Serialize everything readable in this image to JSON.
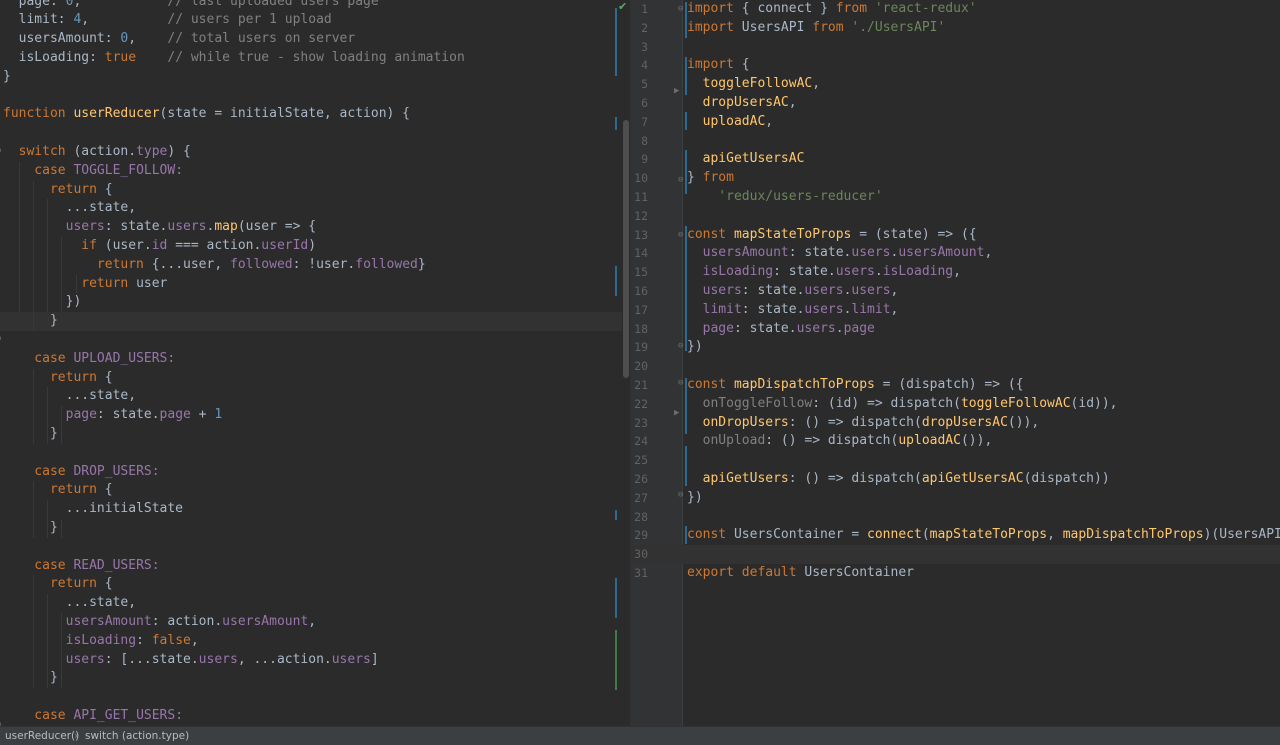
{
  "left_editor": {
    "lines": [
      {
        "segments": [
          {
            "t": "  page: ",
            "c": ""
          },
          {
            "t": "0",
            "c": "n"
          },
          {
            "t": ",           ",
            "c": ""
          },
          {
            "t": "// last uploaded users page",
            "c": "c"
          }
        ]
      },
      {
        "segments": [
          {
            "t": "  limit: ",
            "c": ""
          },
          {
            "t": "4",
            "c": "n"
          },
          {
            "t": ",          ",
            "c": ""
          },
          {
            "t": "// users per 1 upload",
            "c": "c"
          }
        ]
      },
      {
        "segments": [
          {
            "t": "  usersAmount: ",
            "c": ""
          },
          {
            "t": "0",
            "c": "n"
          },
          {
            "t": ",    ",
            "c": ""
          },
          {
            "t": "// total users on server",
            "c": "c"
          }
        ]
      },
      {
        "segments": [
          {
            "t": "  isLoading: ",
            "c": ""
          },
          {
            "t": "true",
            "c": "k"
          },
          {
            "t": "    ",
            "c": ""
          },
          {
            "t": "// while true - show loading animation",
            "c": "c"
          }
        ]
      },
      {
        "segments": [
          {
            "t": "}",
            "c": ""
          }
        ]
      },
      {
        "segments": [
          {
            "t": "",
            "c": ""
          }
        ]
      },
      {
        "segments": [
          {
            "t": "function ",
            "c": "k"
          },
          {
            "t": "userReducer",
            "c": "f"
          },
          {
            "t": "(state = initialState, action) {",
            "c": ""
          }
        ]
      },
      {
        "segments": [
          {
            "t": "",
            "c": ""
          }
        ]
      },
      {
        "segments": [
          {
            "t": "  switch ",
            "c": "k"
          },
          {
            "t": "(action.",
            "c": ""
          },
          {
            "t": "type",
            "c": "p"
          },
          {
            "t": ") {",
            "c": ""
          }
        ]
      },
      {
        "segments": [
          {
            "t": "    case ",
            "c": "k"
          },
          {
            "t": "TOGGLE_FOLLOW:",
            "c": "p"
          }
        ]
      },
      {
        "segments": [
          {
            "t": "      return ",
            "c": "k"
          },
          {
            "t": "{",
            "c": ""
          }
        ]
      },
      {
        "segments": [
          {
            "t": "        ...state,",
            "c": ""
          }
        ]
      },
      {
        "segments": [
          {
            "t": "        users",
            "c": "p"
          },
          {
            "t": ": state.",
            "c": ""
          },
          {
            "t": "users",
            "c": "p"
          },
          {
            "t": ".",
            "c": ""
          },
          {
            "t": "map",
            "c": "f"
          },
          {
            "t": "(user => {",
            "c": ""
          }
        ]
      },
      {
        "segments": [
          {
            "t": "          if ",
            "c": "k"
          },
          {
            "t": "(user.",
            "c": ""
          },
          {
            "t": "id",
            "c": "p"
          },
          {
            "t": " === action.",
            "c": ""
          },
          {
            "t": "userId",
            "c": "p"
          },
          {
            "t": ")",
            "c": ""
          }
        ]
      },
      {
        "segments": [
          {
            "t": "            return ",
            "c": "k"
          },
          {
            "t": "{...user, ",
            "c": ""
          },
          {
            "t": "followed",
            "c": "p"
          },
          {
            "t": ": !user.",
            "c": ""
          },
          {
            "t": "followed",
            "c": "p"
          },
          {
            "t": "}",
            "c": ""
          }
        ]
      },
      {
        "segments": [
          {
            "t": "          return ",
            "c": "k"
          },
          {
            "t": "user",
            "c": ""
          }
        ]
      },
      {
        "segments": [
          {
            "t": "        })",
            "c": ""
          }
        ]
      },
      {
        "segments": [
          {
            "t": "      }",
            "c": ""
          }
        ]
      },
      {
        "segments": [
          {
            "t": "",
            "c": ""
          }
        ]
      },
      {
        "segments": [
          {
            "t": "    case ",
            "c": "k"
          },
          {
            "t": "UPLOAD_USERS:",
            "c": "p"
          }
        ]
      },
      {
        "segments": [
          {
            "t": "      return ",
            "c": "k"
          },
          {
            "t": "{",
            "c": ""
          }
        ]
      },
      {
        "segments": [
          {
            "t": "        ...state,",
            "c": ""
          }
        ]
      },
      {
        "segments": [
          {
            "t": "        page",
            "c": "p"
          },
          {
            "t": ": state.",
            "c": ""
          },
          {
            "t": "page",
            "c": "p"
          },
          {
            "t": " + ",
            "c": ""
          },
          {
            "t": "1",
            "c": "n"
          }
        ]
      },
      {
        "segments": [
          {
            "t": "      }",
            "c": ""
          }
        ]
      },
      {
        "segments": [
          {
            "t": "",
            "c": ""
          }
        ]
      },
      {
        "segments": [
          {
            "t": "    case ",
            "c": "k"
          },
          {
            "t": "DROP_USERS:",
            "c": "p"
          }
        ]
      },
      {
        "segments": [
          {
            "t": "      return ",
            "c": "k"
          },
          {
            "t": "{",
            "c": ""
          }
        ]
      },
      {
        "segments": [
          {
            "t": "        ...initialState",
            "c": ""
          }
        ]
      },
      {
        "segments": [
          {
            "t": "      }",
            "c": ""
          }
        ]
      },
      {
        "segments": [
          {
            "t": "",
            "c": ""
          }
        ]
      },
      {
        "segments": [
          {
            "t": "    case ",
            "c": "k"
          },
          {
            "t": "READ_USERS:",
            "c": "p"
          }
        ]
      },
      {
        "segments": [
          {
            "t": "      return ",
            "c": "k"
          },
          {
            "t": "{",
            "c": ""
          }
        ]
      },
      {
        "segments": [
          {
            "t": "        ...state,",
            "c": ""
          }
        ]
      },
      {
        "segments": [
          {
            "t": "        usersAmount",
            "c": "p"
          },
          {
            "t": ": action.",
            "c": ""
          },
          {
            "t": "usersAmount",
            "c": "p"
          },
          {
            "t": ",",
            "c": ""
          }
        ]
      },
      {
        "segments": [
          {
            "t": "        isLoading",
            "c": "p"
          },
          {
            "t": ": ",
            "c": ""
          },
          {
            "t": "false",
            "c": "k"
          },
          {
            "t": ",",
            "c": ""
          }
        ]
      },
      {
        "segments": [
          {
            "t": "        users",
            "c": "p"
          },
          {
            "t": ": [...state.",
            "c": ""
          },
          {
            "t": "users",
            "c": "p"
          },
          {
            "t": ", ...action.",
            "c": ""
          },
          {
            "t": "users",
            "c": "p"
          },
          {
            "t": "]",
            "c": ""
          }
        ]
      },
      {
        "segments": [
          {
            "t": "      }",
            "c": ""
          }
        ]
      },
      {
        "segments": [
          {
            "t": "",
            "c": ""
          }
        ]
      },
      {
        "segments": [
          {
            "t": "    case ",
            "c": "k"
          },
          {
            "t": "API_GET_USERS:",
            "c": "p"
          }
        ]
      }
    ]
  },
  "right_editor": {
    "lines": [
      {
        "num": "1",
        "segments": [
          {
            "t": "import ",
            "c": "k"
          },
          {
            "t": "{ connect } ",
            "c": ""
          },
          {
            "t": "from ",
            "c": "k"
          },
          {
            "t": "'react-redux'",
            "c": "s"
          }
        ]
      },
      {
        "num": "2",
        "segments": [
          {
            "t": "import ",
            "c": "k"
          },
          {
            "t": "UsersAPI ",
            "c": ""
          },
          {
            "t": "from ",
            "c": "k"
          },
          {
            "t": "'./UsersAPI'",
            "c": "s"
          }
        ]
      },
      {
        "num": "3",
        "segments": [
          {
            "t": "",
            "c": ""
          }
        ]
      },
      {
        "num": "4",
        "segments": [
          {
            "t": "import ",
            "c": "k"
          },
          {
            "t": "{",
            "c": ""
          }
        ]
      },
      {
        "num": "5",
        "segments": [
          {
            "t": "  toggleFollowAC",
            "c": "f"
          },
          {
            "t": ",",
            "c": ""
          }
        ]
      },
      {
        "num": "6",
        "segments": [
          {
            "t": "  dropUsersAC",
            "c": "f"
          },
          {
            "t": ",",
            "c": ""
          }
        ]
      },
      {
        "num": "7",
        "segments": [
          {
            "t": "  uploadAC",
            "c": "f"
          },
          {
            "t": ",",
            "c": ""
          }
        ]
      },
      {
        "num": "8",
        "segments": [
          {
            "t": "",
            "c": ""
          }
        ]
      },
      {
        "num": "9",
        "segments": [
          {
            "t": "  apiGetUsersAC",
            "c": "f"
          }
        ]
      },
      {
        "num": "10",
        "segments": [
          {
            "t": "} ",
            "c": ""
          },
          {
            "t": "from",
            "c": "k"
          }
        ]
      },
      {
        "num": "11",
        "segments": [
          {
            "t": "    'redux/users-reducer'",
            "c": "s"
          }
        ]
      },
      {
        "num": "12",
        "segments": [
          {
            "t": "",
            "c": ""
          }
        ]
      },
      {
        "num": "13",
        "segments": [
          {
            "t": "const ",
            "c": "k"
          },
          {
            "t": "mapStateToProps",
            "c": "f"
          },
          {
            "t": " = (state) => ({",
            "c": ""
          }
        ]
      },
      {
        "num": "14",
        "segments": [
          {
            "t": "  usersAmount",
            "c": "p"
          },
          {
            "t": ": state.",
            "c": ""
          },
          {
            "t": "users",
            "c": "p"
          },
          {
            "t": ".",
            "c": ""
          },
          {
            "t": "usersAmount",
            "c": "p"
          },
          {
            "t": ",",
            "c": ""
          }
        ]
      },
      {
        "num": "15",
        "segments": [
          {
            "t": "  isLoading",
            "c": "p"
          },
          {
            "t": ": state.",
            "c": ""
          },
          {
            "t": "users",
            "c": "p"
          },
          {
            "t": ".",
            "c": ""
          },
          {
            "t": "isLoading",
            "c": "p"
          },
          {
            "t": ",",
            "c": ""
          }
        ]
      },
      {
        "num": "16",
        "segments": [
          {
            "t": "  users",
            "c": "p"
          },
          {
            "t": ": state.",
            "c": ""
          },
          {
            "t": "users",
            "c": "p"
          },
          {
            "t": ".",
            "c": ""
          },
          {
            "t": "users",
            "c": "p"
          },
          {
            "t": ",",
            "c": ""
          }
        ]
      },
      {
        "num": "17",
        "segments": [
          {
            "t": "  limit",
            "c": "p"
          },
          {
            "t": ": state.",
            "c": ""
          },
          {
            "t": "users",
            "c": "p"
          },
          {
            "t": ".",
            "c": ""
          },
          {
            "t": "limit",
            "c": "p"
          },
          {
            "t": ",",
            "c": ""
          }
        ]
      },
      {
        "num": "18",
        "segments": [
          {
            "t": "  page",
            "c": "p"
          },
          {
            "t": ": state.",
            "c": ""
          },
          {
            "t": "users",
            "c": "p"
          },
          {
            "t": ".",
            "c": ""
          },
          {
            "t": "page",
            "c": "p"
          }
        ]
      },
      {
        "num": "19",
        "segments": [
          {
            "t": "})",
            "c": ""
          }
        ]
      },
      {
        "num": "20",
        "segments": [
          {
            "t": "",
            "c": ""
          }
        ]
      },
      {
        "num": "21",
        "segments": [
          {
            "t": "const ",
            "c": "k"
          },
          {
            "t": "mapDispatchToProps",
            "c": "f"
          },
          {
            "t": " = (dispatch) => ({",
            "c": ""
          }
        ]
      },
      {
        "num": "22",
        "segments": [
          {
            "t": "  onToggleFollow",
            "c": "c"
          },
          {
            "t": ": (id) => ",
            "c": ""
          },
          {
            "t": "dispatch",
            "c": ""
          },
          {
            "t": "(",
            "c": ""
          },
          {
            "t": "toggleFollowAC",
            "c": "f"
          },
          {
            "t": "(id)),",
            "c": ""
          }
        ]
      },
      {
        "num": "23",
        "segments": [
          {
            "t": "  onDropUsers",
            "c": "f"
          },
          {
            "t": ": () => dispatch(",
            "c": ""
          },
          {
            "t": "dropUsersAC",
            "c": "f"
          },
          {
            "t": "()),",
            "c": ""
          }
        ]
      },
      {
        "num": "24",
        "segments": [
          {
            "t": "  onUpload",
            "c": "c"
          },
          {
            "t": ": () => dispatch(",
            "c": ""
          },
          {
            "t": "uploadAC",
            "c": "f"
          },
          {
            "t": "()),",
            "c": ""
          }
        ]
      },
      {
        "num": "25",
        "segments": [
          {
            "t": "",
            "c": ""
          }
        ]
      },
      {
        "num": "26",
        "segments": [
          {
            "t": "  apiGetUsers",
            "c": "f"
          },
          {
            "t": ": () => dispatch(",
            "c": ""
          },
          {
            "t": "apiGetUsersAC",
            "c": "f"
          },
          {
            "t": "(dispatch))",
            "c": ""
          }
        ]
      },
      {
        "num": "27",
        "segments": [
          {
            "t": "})",
            "c": ""
          }
        ]
      },
      {
        "num": "28",
        "segments": [
          {
            "t": "",
            "c": ""
          }
        ]
      },
      {
        "num": "29",
        "segments": [
          {
            "t": "const ",
            "c": "k"
          },
          {
            "t": "UsersContainer = ",
            "c": ""
          },
          {
            "t": "connect",
            "c": "f"
          },
          {
            "t": "(",
            "c": ""
          },
          {
            "t": "mapStateToProps",
            "c": "f"
          },
          {
            "t": ", ",
            "c": ""
          },
          {
            "t": "mapDispatchToProps",
            "c": "f"
          },
          {
            "t": ")(UsersAPI)",
            "c": ""
          }
        ]
      },
      {
        "num": "30",
        "segments": [
          {
            "t": "",
            "c": ""
          }
        ]
      },
      {
        "num": "31",
        "segments": [
          {
            "t": "export default ",
            "c": "k"
          },
          {
            "t": "UsersContainer",
            "c": ""
          }
        ]
      }
    ]
  },
  "statusbar": {
    "crumbs": [
      "userReducer()",
      "switch (action.type)"
    ],
    "separator": "›"
  },
  "inspection_icon": "check-icon",
  "colors": {
    "background": "#2b2b2b",
    "keyword": "#cc7832",
    "string": "#6a8759",
    "comment": "#808080",
    "number": "#6897bb",
    "function": "#ffc66d",
    "property": "#9876aa",
    "text": "#a9b7c6"
  }
}
